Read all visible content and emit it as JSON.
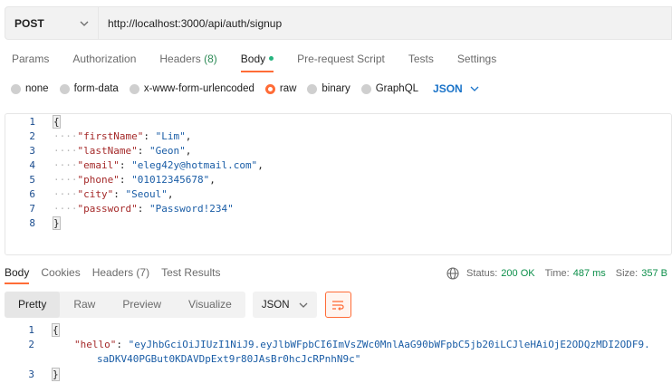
{
  "request": {
    "method": "POST",
    "url": "http://localhost:3000/api/auth/signup"
  },
  "request_tabs": [
    {
      "label": "Params"
    },
    {
      "label": "Authorization"
    },
    {
      "label": "Headers",
      "count": "(8)"
    },
    {
      "label": "Body",
      "active": true
    },
    {
      "label": "Pre-request Script"
    },
    {
      "label": "Tests"
    },
    {
      "label": "Settings"
    }
  ],
  "body_types": {
    "none": "none",
    "form_data": "form-data",
    "urlencoded": "x-www-form-urlencoded",
    "raw": "raw",
    "binary": "binary",
    "graphql": "GraphQL",
    "selected": "raw",
    "language": "JSON"
  },
  "request_body": {
    "line_numbers": [
      "1",
      "2",
      "3",
      "4",
      "5",
      "6",
      "7",
      "8"
    ],
    "open_brace": "{",
    "close_brace": "}",
    "fields": [
      {
        "key": "\"firstName\"",
        "value": "\"Lim\"",
        "comma": ","
      },
      {
        "key": "\"lastName\"",
        "value": "\"Geon\"",
        "comma": ","
      },
      {
        "key": "\"email\"",
        "value": "\"eleg42y@hotmail.com\"",
        "comma": ","
      },
      {
        "key": "\"phone\"",
        "value": "\"01012345678\"",
        "comma": ","
      },
      {
        "key": "\"city\"",
        "value": "\"Seoul\"",
        "comma": ","
      },
      {
        "key": "\"password\"",
        "value": "\"Password!234\"",
        "comma": ""
      }
    ]
  },
  "response_tabs": [
    {
      "label": "Body",
      "active": true
    },
    {
      "label": "Cookies"
    },
    {
      "label": "Headers",
      "count": "(7)"
    },
    {
      "label": "Test Results"
    }
  ],
  "status": {
    "status_label": "Status:",
    "status_value": "200 OK",
    "time_label": "Time:",
    "time_value": "487 ms",
    "size_label": "Size:",
    "size_value": "357 B"
  },
  "view_modes": [
    "Pretty",
    "Raw",
    "Preview",
    "Visualize"
  ],
  "response_format": "JSON",
  "response_body": {
    "line_numbers": [
      "1",
      "2",
      "3"
    ],
    "open_brace": "{",
    "close_brace": "}",
    "key": "\"hello\"",
    "value_line1": "\"eyJhbGciOiJIUzI1NiJ9.eyJlbWFpbCI6ImVsZWc0MnlAaG90bWFpbC5jb20iLCJleHAiOjE2ODQzMDI2ODF9.",
    "value_line2": "saDKV40PGBut0KDAVDpExt9r80JAsBr0hcJcRPnhN9c\""
  },
  "colors": {
    "accent": "#ff6c37",
    "status_ok": "#0c8f4a",
    "json_key": "#a52a2a",
    "json_string": "#1a5da6"
  }
}
